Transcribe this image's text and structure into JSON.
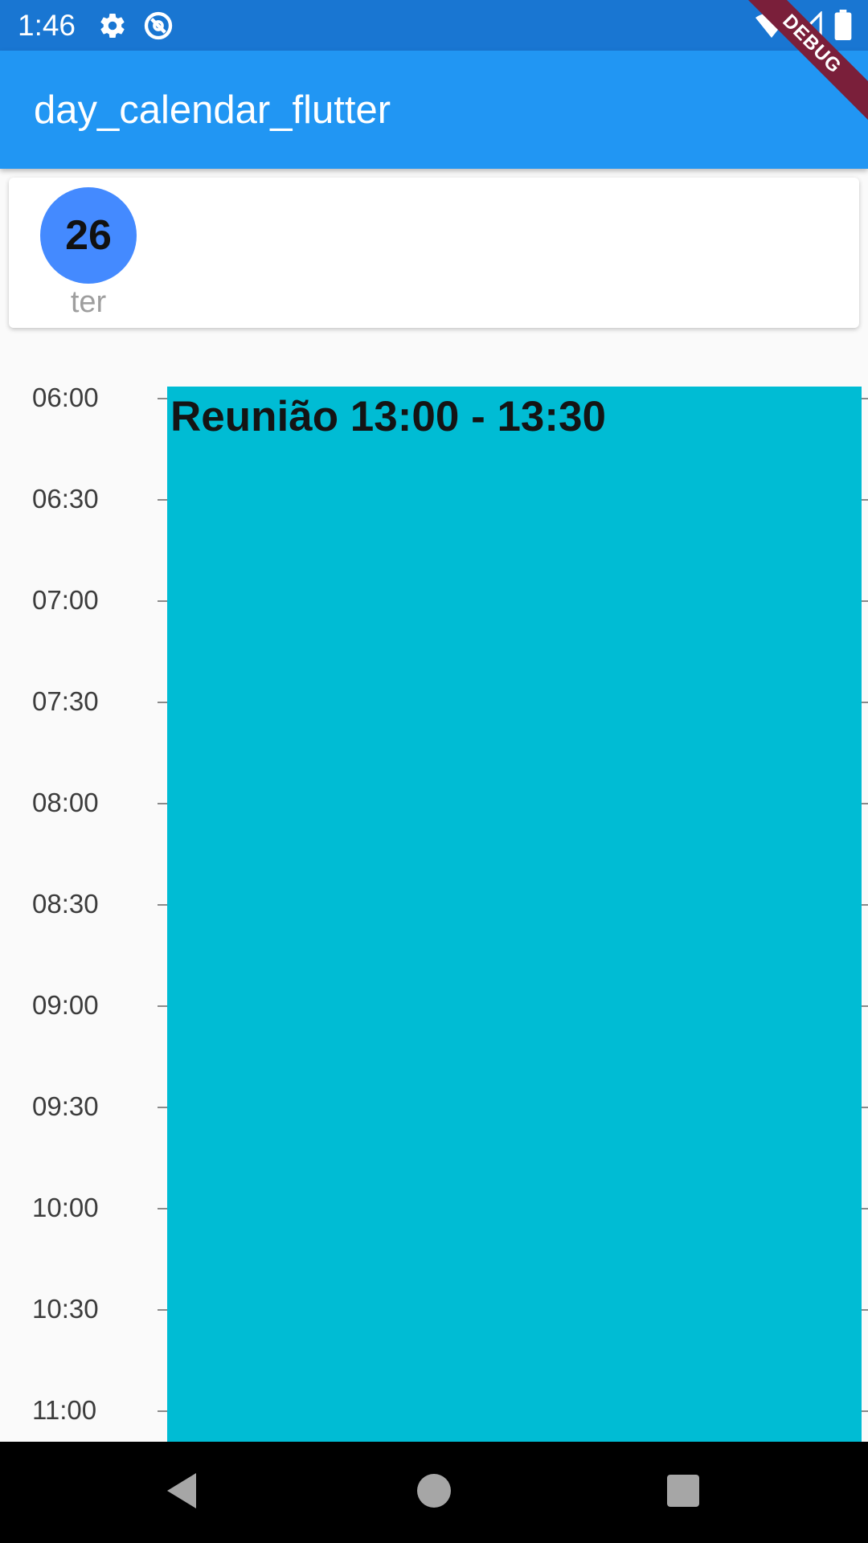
{
  "status_bar": {
    "time": "1:46",
    "icons": [
      "gear-icon",
      "sync-icon",
      "wifi-icon",
      "signal-icon",
      "battery-icon"
    ],
    "background": "#1976d2"
  },
  "app_bar": {
    "title": "day_calendar_flutter",
    "background": "#2196f3"
  },
  "debug_banner": {
    "label": "DEBUG",
    "color": "#7a1f3a"
  },
  "day_header": {
    "day_number": "26",
    "weekday": "ter",
    "circle_color": "#448aff"
  },
  "timeline": {
    "slots": [
      "06:00",
      "06:30",
      "07:00",
      "07:30",
      "08:00",
      "08:30",
      "09:00",
      "09:30",
      "10:00",
      "10:30",
      "11:00"
    ]
  },
  "event": {
    "title": "Reunião 13:00 - 13:30",
    "color": "#00bcd4"
  },
  "nav_bar": {
    "buttons": [
      "back-icon",
      "home-icon",
      "recents-icon"
    ]
  }
}
